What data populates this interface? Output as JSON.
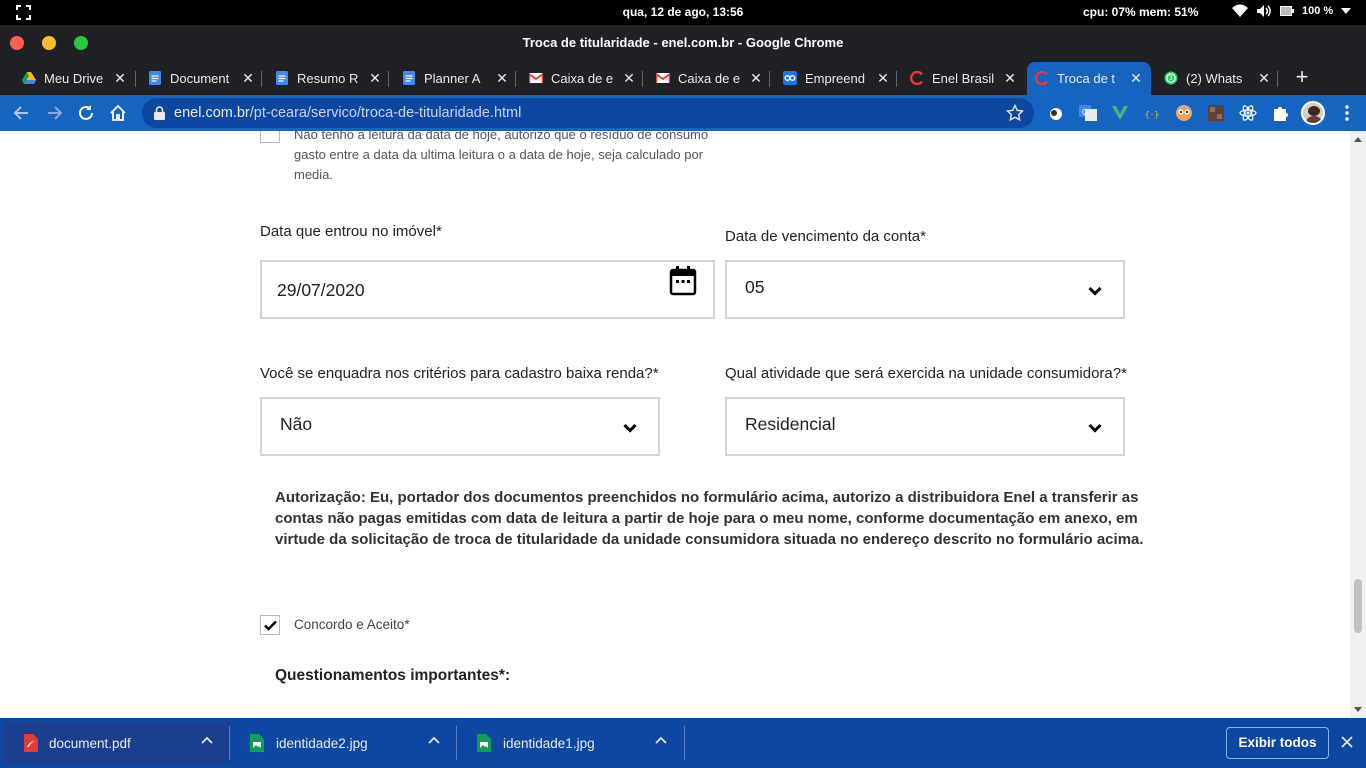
{
  "topbar": {
    "clock": "qua, 12 de ago, 13:56",
    "sysmon": "cpu: 07% mem: 51%",
    "battery": "100 %"
  },
  "window": {
    "title": "Troca de titularidade - enel.com.br - Google Chrome"
  },
  "tabs": [
    {
      "label": "Meu Drive",
      "icon": "google-drive-icon"
    },
    {
      "label": "Document",
      "icon": "google-docs-icon"
    },
    {
      "label": "Resumo R",
      "icon": "google-docs-icon"
    },
    {
      "label": "Planner A",
      "icon": "google-docs-icon"
    },
    {
      "label": "Caixa de e",
      "icon": "gmail-icon"
    },
    {
      "label": "Caixa de e",
      "icon": "gmail-icon"
    },
    {
      "label": "Empreend",
      "icon": "link-icon"
    },
    {
      "label": "Enel Brasil",
      "icon": "enel-icon"
    },
    {
      "label": "Troca de t",
      "icon": "enel-icon"
    },
    {
      "label": "(2) Whats",
      "icon": "whatsapp-icon"
    }
  ],
  "omnibox": {
    "domain": "enel.com.br",
    "path": "/pt-ceara/servico/troca-de-titularidade.html"
  },
  "form": {
    "leitura_note": "Não tenho a leitura da data de hoje, autorizo que o resíduo de consumo gasto entre a data da ultima leitura o a data de hoje, seja calculado por media.",
    "data_entrada_label": "Data que entrou no imóvel*",
    "data_entrada_value": "29/07/2020",
    "vencimento_label": "Data de vencimento da conta*",
    "vencimento_value": "05",
    "baixa_renda_label": "Você se enquadra nos critérios para cadastro baixa renda?*",
    "baixa_renda_value": "Não",
    "atividade_label": "Qual atividade que será exercida na unidade consumidora?*",
    "atividade_value": "Residencial",
    "autorizacao_text": "Autorização: Eu, portador dos documentos preenchidos no formulário acima, autorizo a distribuidora Enel a transferir as contas não pagas emitidas com data de leitura a partir de hoje para o meu nome, conforme documentação em anexo, em virtude da solicitação de troca de titularidade da unidade consumidora situada no endereço descrito no formulário acima.",
    "concordo_label": "Concordo e Aceito*",
    "concordo_checked": true,
    "questionamentos_label": "Questionamentos importantes*:"
  },
  "downloads": {
    "items": [
      {
        "name": "document.pdf",
        "icon": "pdf-file-icon"
      },
      {
        "name": "identidade2.jpg",
        "icon": "image-file-icon"
      },
      {
        "name": "identidade1.jpg",
        "icon": "image-file-icon"
      }
    ],
    "show_all": "Exibir todos"
  },
  "colors": {
    "toolbar": "#1565c0",
    "shelf": "#0d47a1",
    "tabstrip": "#202124"
  }
}
